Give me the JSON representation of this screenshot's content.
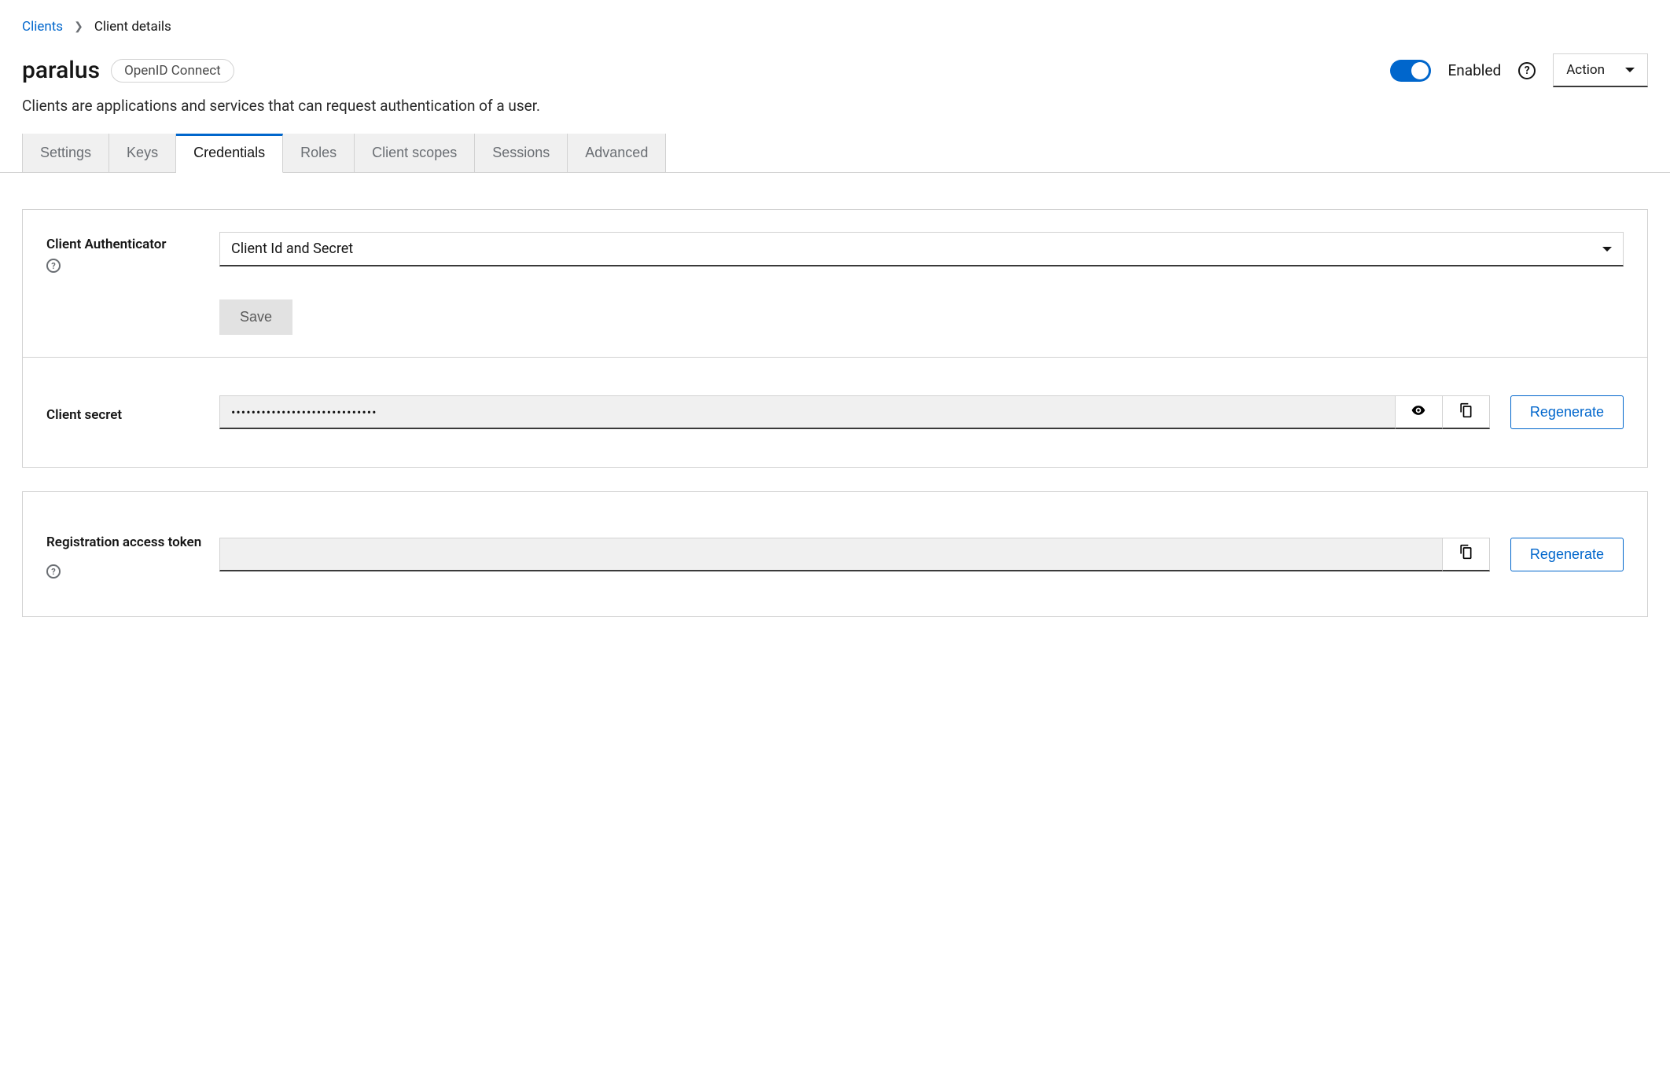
{
  "breadcrumb": {
    "root": "Clients",
    "current": "Client details"
  },
  "header": {
    "title": "paralus",
    "badge": "OpenID Connect",
    "enabled_label": "Enabled",
    "action_label": "Action"
  },
  "description": "Clients are applications and services that can request authentication of a user.",
  "tabs": {
    "settings": "Settings",
    "keys": "Keys",
    "credentials": "Credentials",
    "roles": "Roles",
    "client_scopes": "Client scopes",
    "sessions": "Sessions",
    "advanced": "Advanced"
  },
  "credentials": {
    "authenticator_label": "Client Authenticator",
    "authenticator_value": "Client Id and Secret",
    "save_label": "Save",
    "client_secret_label": "Client secret",
    "client_secret_value": "•••••••••••••••••••••••••••••",
    "regenerate_label": "Regenerate",
    "reg_token_label": "Registration access token",
    "reg_token_value": ""
  }
}
